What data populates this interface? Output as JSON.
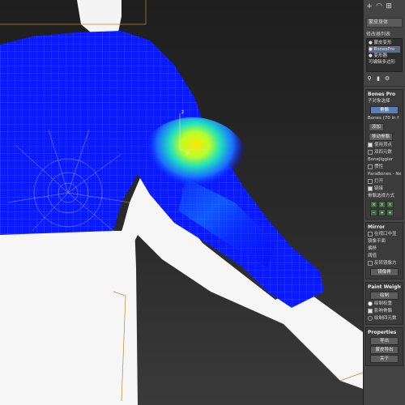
{
  "toolbar": {
    "icons": [
      "plus-icon",
      "arc-icon",
      "hierarchy-icon"
    ]
  },
  "object_name": "蒙皮身体",
  "modifier_list_label": "修改器列表",
  "modifier_stack": [
    {
      "label": "● 蒙皮变形",
      "selected": false
    },
    {
      "label": "● BonesPro",
      "selected": true
    },
    {
      "label": "● 变形器",
      "selected": false
    },
    {
      "label": "可编辑多边形",
      "selected": false
    }
  ],
  "bones_pro": {
    "title": "Bones Pro",
    "subtitle": "子对象选择",
    "active_button": "骨骼",
    "bones_label": "Bones (70 in f",
    "buttons": [
      "添加",
      "移动骨骼"
    ],
    "checks": [
      {
        "label": "使用顶点",
        "checked": true
      },
      {
        "label": "双四元数",
        "checked": false
      }
    ],
    "bonejiggler": "BoneJiggler",
    "inertia": "惯性",
    "parabones": "ParaBones - Ne",
    "open": "打开",
    "on": "链接",
    "select_mode": "骨骼选择方式"
  },
  "mirror": {
    "title": "Mirror",
    "items": [
      "在视口中显",
      "镜像平面",
      "偏移",
      "阈值"
    ],
    "mirror_button": "反转镜像方",
    "apply": "镜像骨"
  },
  "paint": {
    "title": "Paint Weight",
    "button": "绘制",
    "radio1": "绘制权重",
    "check1": "影响骨骼",
    "radio2": "绘制四元数"
  },
  "properties": {
    "title": "Properties",
    "buttons": [
      "导出",
      "蒙皮导出",
      "关于"
    ]
  },
  "viewport": {
    "gizmo_x": "y",
    "gizmo_z": "z"
  }
}
